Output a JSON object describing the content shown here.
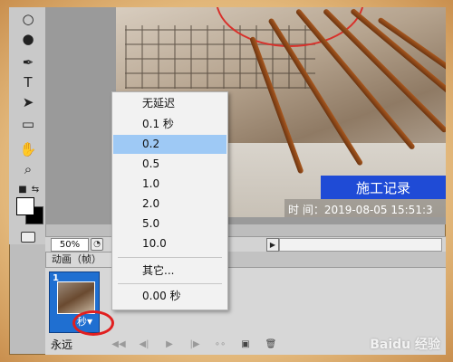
{
  "canvas": {
    "watermark_title": "施工记录",
    "watermark_time": "时    间：2019-08-05 15:51:3"
  },
  "statusbar": {
    "zoom": "50%"
  },
  "animation_panel": {
    "tab_label": "动画（帧）",
    "frame_number": "1",
    "frame_delay": "秒",
    "loop": "永远"
  },
  "delay_menu": {
    "items": [
      {
        "label": "无延迟"
      },
      {
        "label": "0.1 秒"
      },
      {
        "label": "0.2",
        "selected": true
      },
      {
        "label": "0.5"
      },
      {
        "label": "1.0"
      },
      {
        "label": "2.0"
      },
      {
        "label": "5.0"
      },
      {
        "label": "10.0"
      },
      {
        "label": "其它..."
      },
      {
        "label": "0.00 秒"
      }
    ]
  },
  "brand": "Baidu 经验",
  "colors": {
    "highlight": "#9ec9f5",
    "frame_selected": "#1f6fd1",
    "watermark_banner": "#1f4bd6",
    "annotation_red": "#e11f1f"
  },
  "icons": [
    "ellipse-marquee-icon",
    "zoom-icon",
    "pen-icon",
    "type-icon",
    "path-select-icon",
    "rectangle-icon",
    "hand-icon",
    "magnifier-icon",
    "swap-colors-icon",
    "quick-mask-icon"
  ]
}
